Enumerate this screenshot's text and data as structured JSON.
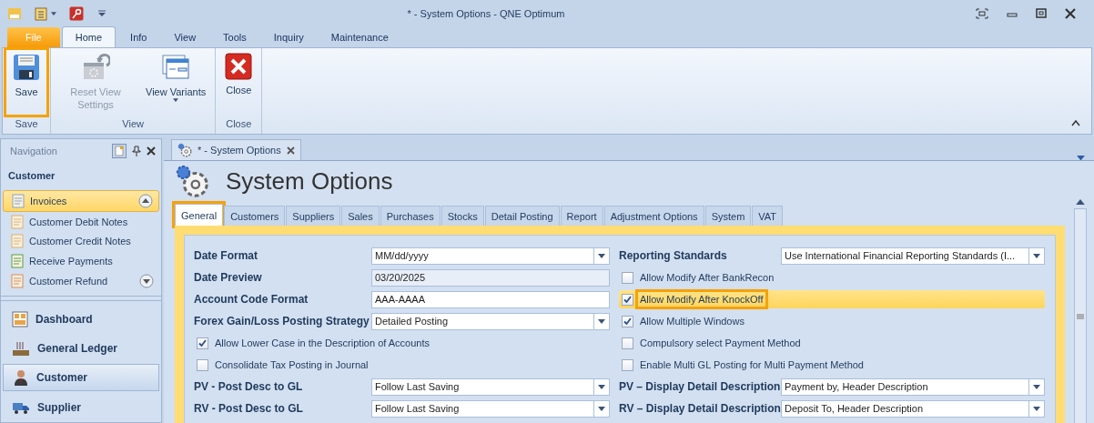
{
  "window": {
    "title": "*  - System Options - QNE Optimum"
  },
  "ribbon_tabs": [
    {
      "label": "File",
      "kind": "file"
    },
    {
      "label": "Home",
      "kind": "tab",
      "selected": true
    },
    {
      "label": "Info",
      "kind": "tab",
      "selected": false
    },
    {
      "label": "View",
      "kind": "tab",
      "selected": false
    },
    {
      "label": "Tools",
      "kind": "tab",
      "selected": false
    },
    {
      "label": "Inquiry",
      "kind": "tab",
      "selected": false
    },
    {
      "label": "Maintenance",
      "kind": "tab",
      "selected": false
    }
  ],
  "ribbon_groups": [
    {
      "label": "Save",
      "buttons": [
        {
          "label": "Save",
          "disabled": false,
          "highlighted": true,
          "menu": false
        }
      ]
    },
    {
      "label": "View",
      "buttons": [
        {
          "label": "Reset View Settings",
          "disabled": true,
          "highlighted": false,
          "menu": false
        },
        {
          "label": "View Variants",
          "disabled": false,
          "highlighted": false,
          "menu": true
        }
      ]
    },
    {
      "label": "Close",
      "buttons": [
        {
          "label": "Close",
          "disabled": false,
          "highlighted": false,
          "menu": false
        }
      ]
    }
  ],
  "navigation": {
    "title": "Navigation",
    "section": "Customer",
    "items": [
      {
        "label": "Invoices",
        "selected": true
      },
      {
        "label": "Customer Debit Notes",
        "selected": false
      },
      {
        "label": "Customer Credit Notes",
        "selected": false
      },
      {
        "label": "Receive Payments",
        "selected": false
      },
      {
        "label": "Customer Refund",
        "selected": false
      }
    ],
    "modules": [
      {
        "label": "Dashboard",
        "selected": false
      },
      {
        "label": "General Ledger",
        "selected": false
      },
      {
        "label": "Customer",
        "selected": true
      },
      {
        "label": "Supplier",
        "selected": false
      }
    ]
  },
  "document_tab": {
    "label": "*  - System Options"
  },
  "page_title": "System Options",
  "tabs": [
    {
      "label": "General",
      "selected": true,
      "highlighted": true
    },
    {
      "label": "Customers",
      "selected": false,
      "highlighted": false
    },
    {
      "label": "Suppliers",
      "selected": false,
      "highlighted": false
    },
    {
      "label": "Sales",
      "selected": false,
      "highlighted": false
    },
    {
      "label": "Purchases",
      "selected": false,
      "highlighted": false
    },
    {
      "label": "Stocks",
      "selected": false,
      "highlighted": false
    },
    {
      "label": "Detail Posting",
      "selected": false,
      "highlighted": false
    },
    {
      "label": "Report",
      "selected": false,
      "highlighted": false
    },
    {
      "label": "Adjustment Options",
      "selected": false,
      "highlighted": false
    },
    {
      "label": "System",
      "selected": false,
      "highlighted": false
    },
    {
      "label": "VAT",
      "selected": false,
      "highlighted": false
    }
  ],
  "left_fields": [
    {
      "kind": "dropdown",
      "label": "Date Format",
      "value": "MM/dd/yyyy"
    },
    {
      "kind": "readonly",
      "label": "Date Preview",
      "value": "03/20/2025"
    },
    {
      "kind": "text",
      "label": "Account Code Format",
      "value": "AAA-AAAA"
    },
    {
      "kind": "dropdown",
      "label": "Forex Gain/Loss Posting Strategy",
      "value": "Detailed Posting"
    },
    {
      "kind": "checkbox",
      "label": "Allow Lower Case in the Description of Accounts",
      "checked": true,
      "focused": false,
      "highlighted": false
    },
    {
      "kind": "checkbox",
      "label": "Consolidate Tax Posting in Journal",
      "checked": false,
      "focused": false,
      "highlighted": false
    },
    {
      "kind": "dropdown",
      "label": "PV - Post Desc to GL",
      "value": "Follow Last Saving"
    },
    {
      "kind": "dropdown",
      "label": "RV - Post Desc to GL",
      "value": "Follow Last Saving"
    }
  ],
  "right_fields": [
    {
      "kind": "dropdown",
      "label": "Reporting Standards",
      "value": "Use International Financial Reporting Standards (I..."
    },
    {
      "kind": "checkbox",
      "label": "Allow Modify After BankRecon",
      "checked": false,
      "focused": false,
      "highlighted": false
    },
    {
      "kind": "checkbox",
      "label": "Allow Modify After KnockOff",
      "checked": true,
      "focused": true,
      "highlighted": true
    },
    {
      "kind": "checkbox",
      "label": "Allow Multiple Windows",
      "checked": true,
      "focused": false,
      "highlighted": false
    },
    {
      "kind": "checkbox",
      "label": "Compulsory select Payment Method",
      "checked": false,
      "focused": false,
      "highlighted": false
    },
    {
      "kind": "checkbox",
      "label": "Enable Multi GL Posting for Multi Payment Method",
      "checked": false,
      "focused": false,
      "highlighted": false
    },
    {
      "kind": "dropdown",
      "label": "PV – Display Detail Description",
      "value": "Payment by, Header Description"
    },
    {
      "kind": "dropdown",
      "label": "RV – Display Detail Description",
      "value": "Deposit To, Header Description"
    }
  ]
}
